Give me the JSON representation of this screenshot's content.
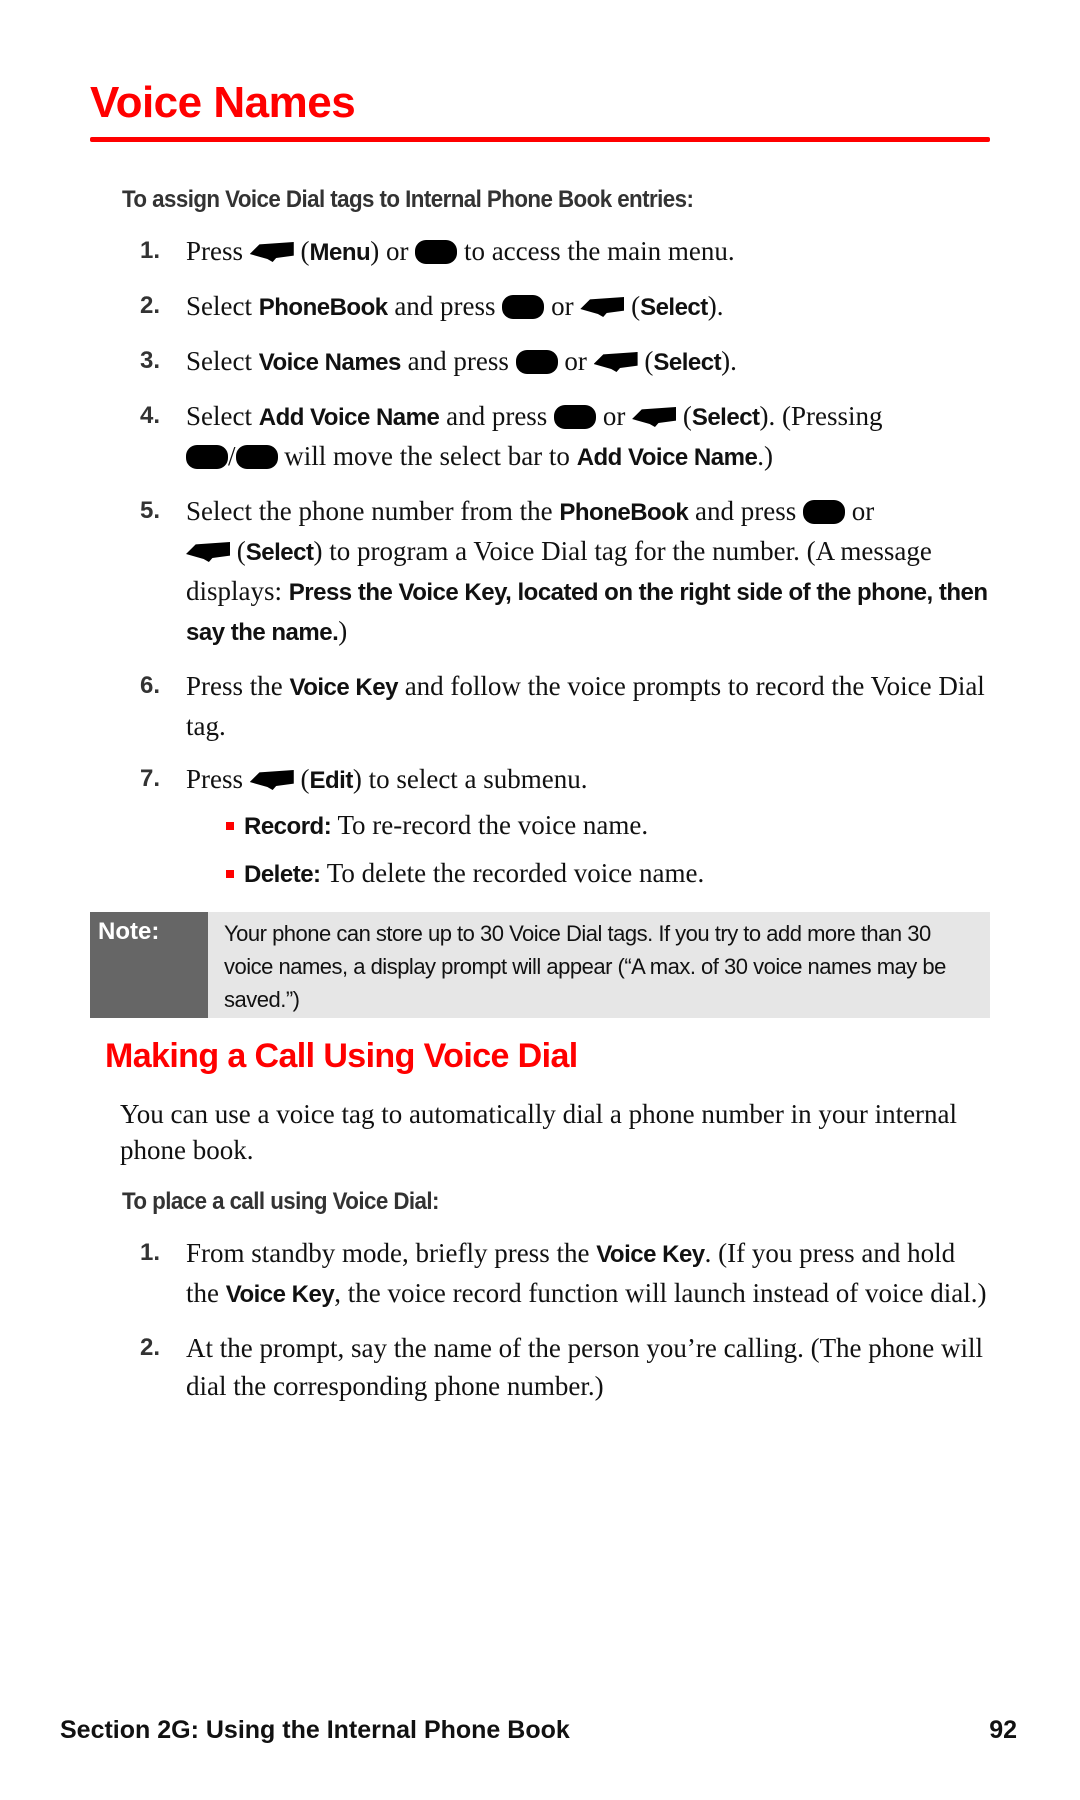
{
  "page": {
    "title": "Voice Names",
    "accent_color": "#ff0000"
  },
  "assign": {
    "subheading": "To assign Voice Dial tags to Internal Phone Book entries:",
    "steps": [
      {
        "num": "1.",
        "parts": {
          "a": "Press ",
          "b": "Menu",
          "c": " to access the main menu.",
          "or": "or"
        }
      },
      {
        "num": "2.",
        "parts": {
          "a": "Select ",
          "b": "PhoneBook",
          "c": " and press ",
          "or": " or ",
          "d": "Select"
        }
      },
      {
        "num": "3.",
        "parts": {
          "a": "Select ",
          "b": "Voice Names",
          "c": " and press ",
          "or": " or ",
          "d": "Select"
        }
      },
      {
        "num": "4.",
        "parts": {
          "a": "Select ",
          "b": "Add Voice Name",
          "c": " and press ",
          "or": " or ",
          "d": "Select",
          "e": ". (Pressing ",
          "f": " will move the select bar to ",
          "g": "Add Voice Name",
          "h": ".)"
        }
      },
      {
        "num": "5.",
        "parts": {
          "a": "Select the phone number from the ",
          "b": "PhoneBook",
          "c": " and press ",
          "or": " or",
          "d": "Select",
          "e": ") to program a Voice Dial tag for the number. (A message displays: ",
          "f": "Press the Voice Key, located on the right side of the phone, then say the name.",
          "g": ")"
        }
      },
      {
        "num": "6.",
        "parts": {
          "a": "Press the ",
          "b": "Voice Key",
          "c": " and follow the voice prompts to record the Voice Dial tag."
        }
      },
      {
        "num": "7.",
        "parts": {
          "a": "Press ",
          "b": "Edit",
          "c": ") to select a submenu."
        }
      }
    ],
    "submenu": [
      {
        "label": "Record:",
        "text": " To re-record the voice name."
      },
      {
        "label": "Delete:",
        "text": " To delete the recorded voice name."
      }
    ]
  },
  "note": {
    "label": "Note:",
    "text": "Your phone can store up to 30 Voice Dial tags. If you try to add more than 30 voice names, a display prompt will appear (“A max. of 30 voice names may be saved.”)"
  },
  "voice_dial": {
    "heading": "Making a Call Using Voice Dial",
    "intro": "You can use a voice tag to automatically dial a phone number in your internal phone book.",
    "subheading": "To place a call using Voice Dial:",
    "steps": [
      {
        "num": "1.",
        "parts": {
          "a": "From standby mode, briefly press the ",
          "b": "Voice Key",
          "c": ". (If you press and hold the ",
          "d": "Voice Key",
          "e": ", the voice record function will launch instead of voice dial.)"
        }
      },
      {
        "num": "2.",
        "parts": {
          "a": "At the prompt, say the name of the person you’re calling. (The phone will dial the corresponding phone number.)"
        }
      }
    ]
  },
  "footer": {
    "section": "Section 2G: Using the Internal Phone Book",
    "page_number": "92"
  }
}
